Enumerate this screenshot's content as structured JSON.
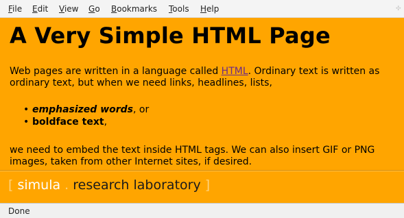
{
  "menu": {
    "items": [
      {
        "label": "File"
      },
      {
        "label": "Edit"
      },
      {
        "label": "View"
      },
      {
        "label": "Go"
      },
      {
        "label": "Bookmarks"
      },
      {
        "label": "Tools"
      },
      {
        "label": "Help"
      }
    ]
  },
  "page": {
    "heading": "A Very Simple HTML Page",
    "para1_before_link": "Web pages are written in a language called ",
    "para1_link": "HTML",
    "para1_after_link": ". Ordinary text is written as ordinary text, but when we need links, headlines, lists,",
    "list_items": [
      {
        "styled": "emphasized words",
        "rest": ", or"
      },
      {
        "styled": "boldface text",
        "rest": ","
      }
    ],
    "bullet": "•",
    "para2": "we need to embed the text inside HTML tags. We can also insert GIF or PNG images, taken from other Internet sites, if desired."
  },
  "logo": {
    "open_bracket": "[",
    "simula": "simula",
    "dot": ".",
    "research": "research laboratory",
    "close_bracket": "]"
  },
  "status": {
    "text": "Done"
  },
  "colors": {
    "page_background": "#ffa500",
    "link": "#6b2b86"
  }
}
